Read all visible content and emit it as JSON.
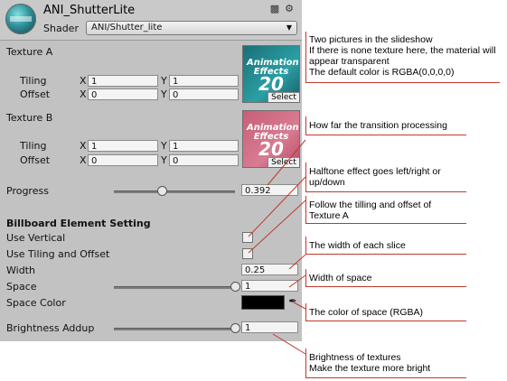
{
  "header": {
    "title": "ANI_ShutterLite",
    "shader_label": "Shader",
    "shader_value": "ANI/Shutter_lite",
    "book_icon": "book-icon",
    "gear_icon": "gear-icon"
  },
  "texture_a": {
    "label": "Texture A",
    "tiling_label": "Tiling",
    "offset_label": "Offset",
    "tiling_x": "1",
    "tiling_y": "1",
    "offset_x": "0",
    "offset_y": "0",
    "thumb_line1": "Animation",
    "thumb_line2": "Effects",
    "thumb_num": "20",
    "select_label": "Select",
    "color": "#2aa0a5"
  },
  "texture_b": {
    "label": "Texture B",
    "tiling_label": "Tiling",
    "offset_label": "Offset",
    "tiling_x": "1",
    "tiling_y": "1",
    "offset_x": "0",
    "offset_y": "0",
    "thumb_line1": "Animation",
    "thumb_line2": "Effects",
    "thumb_num": "20",
    "select_label": "Select",
    "color": "#d77c92"
  },
  "axes": {
    "x": "X",
    "y": "Y"
  },
  "progress": {
    "label": "Progress",
    "value": "0.392",
    "level": 0.392
  },
  "billboard": {
    "heading": "Billboard Element Setting",
    "use_vertical": "Use Vertical",
    "use_tiling_offset": "Use Tiling and Offset",
    "width_label": "Width",
    "width_value": "0.25",
    "space_label": "Space",
    "space_value": "1",
    "space_level": 1,
    "space_color_label": "Space Color",
    "space_color": "#000000",
    "brightness_label": "Brightness Addup",
    "brightness_value": "1",
    "brightness_level": 1
  },
  "notes": {
    "n1": [
      "Two pictures in the slideshow",
      "If there is none texture here, the material will",
      "appear transparent",
      "The default color is RGBA(0,0,0,0)"
    ],
    "n2": [
      "How far the transition processing"
    ],
    "n3": [
      "Halftone effect goes left/right or",
      "up/down"
    ],
    "n4": [
      "Follow the tilling and offset of",
      "Texture A"
    ],
    "n5": [
      "The width of each slice"
    ],
    "n6": [
      "Width of space"
    ],
    "n7": [
      "The color of space (RGBA)"
    ],
    "n8": [
      "Brightness of textures",
      "Make the texture more bright"
    ]
  },
  "colors": {
    "annotation": "#c0392b",
    "inspector": "#c2c2c2"
  }
}
